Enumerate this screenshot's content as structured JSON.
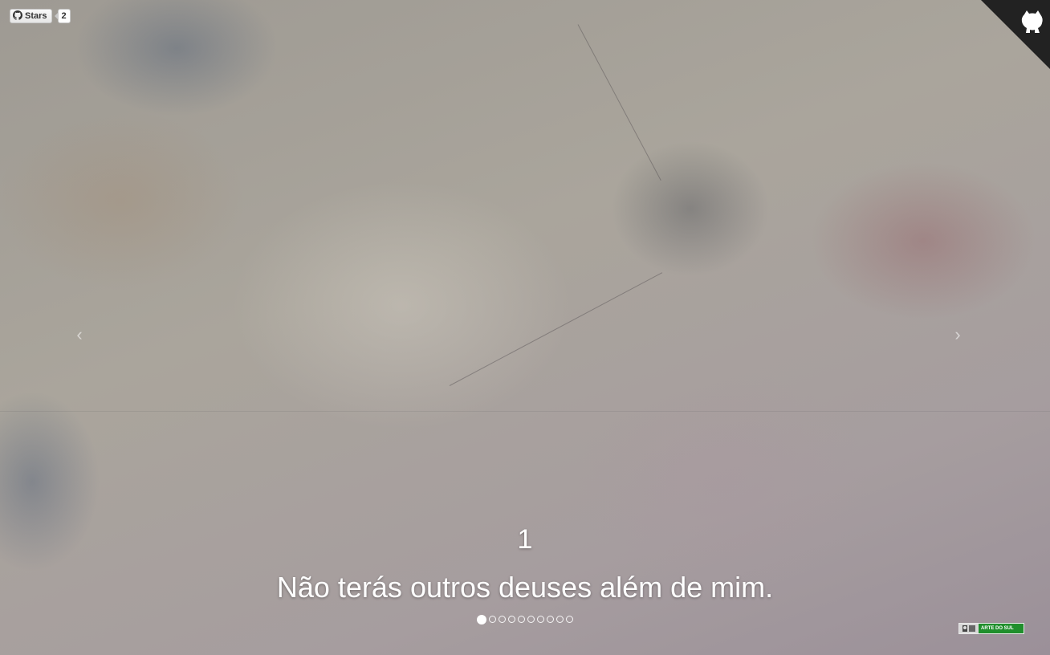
{
  "github": {
    "stars_label": "Stars",
    "stars_count": "2"
  },
  "slide": {
    "number": "1",
    "text": "Não terás outros deuses além de mim."
  },
  "navigation": {
    "prev_arrow": "‹",
    "next_arrow": "›"
  },
  "pagination": {
    "total": 10,
    "active_index": 0
  },
  "badge": {
    "label": "ARTE DO SUL"
  },
  "colors": {
    "text": "#ffffff",
    "corner": "#222222",
    "badge": "#1f8f2c"
  },
  "icons": {
    "github": "github-mark-icon",
    "corner": "octocat-icon",
    "prev": "chevron-left-icon",
    "next": "chevron-right-icon"
  }
}
